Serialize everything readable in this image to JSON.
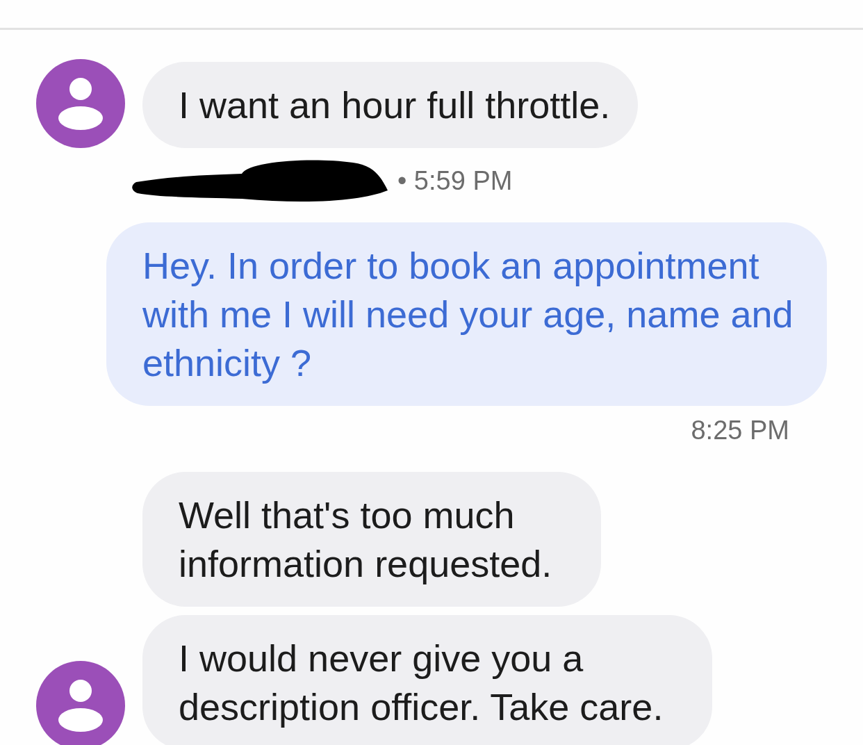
{
  "messages": [
    {
      "kind": "incoming",
      "text": "I want an hour full throttle.",
      "avatar": true,
      "meta": {
        "text": "• 5:59 PM",
        "redacted": true
      }
    },
    {
      "kind": "outgoing",
      "text": "Hey. In order to book an appointment with me I will need your age, name and ethnicity ?",
      "meta": {
        "text": "8:25 PM",
        "redacted": false
      }
    },
    {
      "kind": "incoming",
      "text": "Well that's too much information requested.",
      "avatar": false
    },
    {
      "kind": "incoming",
      "text": "I would never give you a description officer. Take care.",
      "avatar": true
    }
  ]
}
